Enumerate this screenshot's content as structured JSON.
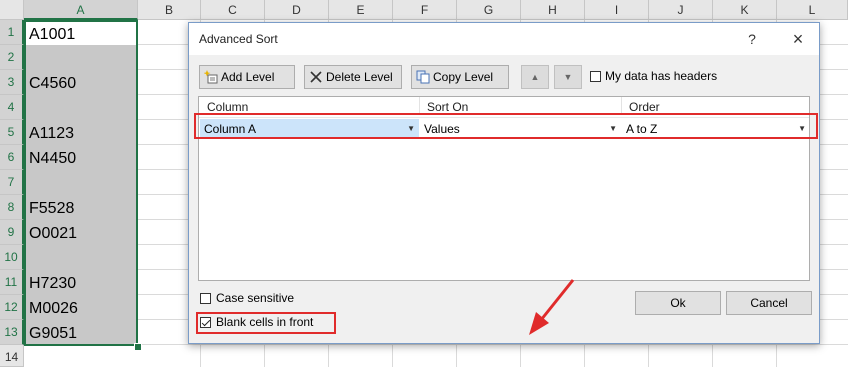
{
  "spreadsheet": {
    "columns": [
      "A",
      "B",
      "C",
      "D",
      "E",
      "F",
      "G",
      "H",
      "I",
      "J",
      "K",
      "L"
    ],
    "rows": [
      "1",
      "2",
      "3",
      "4",
      "5",
      "6",
      "7",
      "8",
      "9",
      "10",
      "11",
      "12",
      "13",
      "14"
    ],
    "column_a_values": [
      "A1001",
      "",
      "C4560",
      "",
      "A1123",
      "N4450",
      "",
      "F5528",
      "O0021",
      "",
      "H7230",
      "M0026",
      "G9051"
    ]
  },
  "dialog": {
    "title": "Advanced Sort",
    "help_label": "?",
    "close_label": "×",
    "toolbar": {
      "add_level": "Add Level",
      "delete_level": "Delete Level",
      "copy_level": "Copy Level",
      "move_up": "▲",
      "move_down": "▼",
      "my_data_has_headers": "My data has headers"
    },
    "list": {
      "headers": {
        "column": "Column",
        "sort_on": "Sort On",
        "order": "Order"
      },
      "row": {
        "column": "Column A",
        "sort_on": "Values",
        "order": "A to Z"
      },
      "dropdown_glyph": "▼"
    },
    "options": {
      "case_sensitive": "Case sensitive",
      "case_sensitive_checked": false,
      "blank_cells_in_front": "Blank cells in front",
      "blank_cells_in_front_checked": true
    },
    "buttons": {
      "ok": "Ok",
      "cancel": "Cancel"
    },
    "highlight_color": "#e02b2b"
  }
}
